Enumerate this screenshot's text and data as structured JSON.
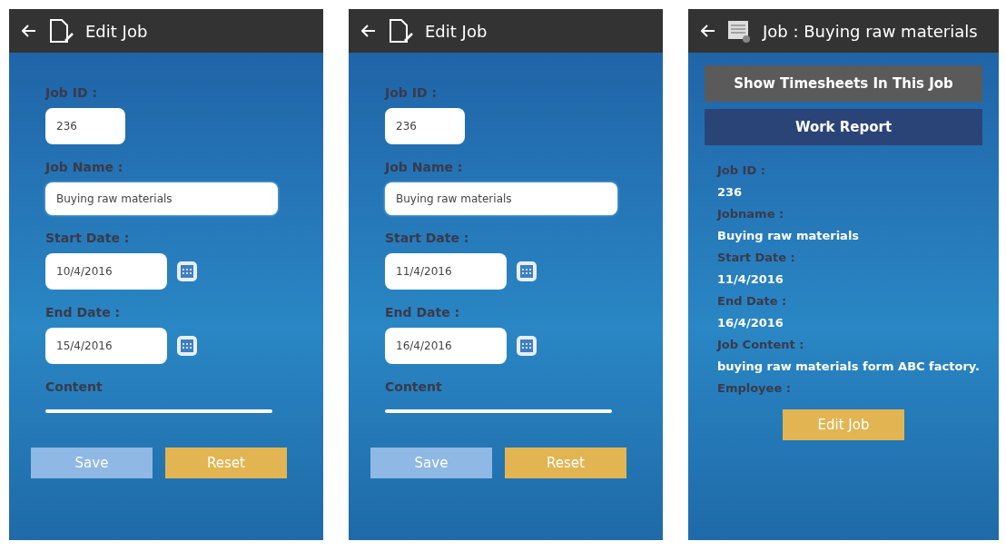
{
  "screens": [
    {
      "kind": "form",
      "title": "Edit Job",
      "fields": [
        {
          "label": "Job ID :",
          "value": "236",
          "kind": "short"
        },
        {
          "label": "Job Name :",
          "value": "Buying raw materials",
          "kind": "wide"
        },
        {
          "label": "Start Date :",
          "value": "10/4/2016",
          "kind": "date"
        },
        {
          "label": "End Date :",
          "value": "15/4/2016",
          "kind": "date"
        },
        {
          "label": "Content",
          "kind": "area"
        }
      ],
      "buttons": [
        {
          "label": "Save",
          "kind": "save"
        },
        {
          "label": "Reset",
          "kind": "reset"
        }
      ]
    },
    {
      "kind": "form",
      "title": "Edit Job",
      "fields": [
        {
          "label": "Job ID :",
          "value": "236",
          "kind": "short"
        },
        {
          "label": "Job Name :",
          "value": "Buying raw materials",
          "kind": "wide"
        },
        {
          "label": "Start Date :",
          "value": "11/4/2016",
          "kind": "date"
        },
        {
          "label": "End Date :",
          "value": "16/4/2016",
          "kind": "date"
        },
        {
          "label": "Content",
          "kind": "area"
        }
      ],
      "buttons": [
        {
          "label": "Save",
          "kind": "save"
        },
        {
          "label": "Reset",
          "kind": "reset"
        }
      ]
    },
    {
      "kind": "details",
      "title": "Job : Buying raw materials",
      "actions": [
        {
          "label": "Show Timesheets In This Job",
          "kind": "grey"
        },
        {
          "label": "Work Report",
          "kind": "navy"
        }
      ],
      "details": [
        {
          "label": "Job ID :",
          "value": "236"
        },
        {
          "label": "Jobname :",
          "value": "Buying raw materials"
        },
        {
          "label": "Start Date :",
          "value": "11/4/2016"
        },
        {
          "label": "End Date :",
          "value": "16/4/2016"
        },
        {
          "label": "Job Content :",
          "value": "buying raw materials form ABC factory."
        },
        {
          "label": "Employee :"
        }
      ],
      "buttons": [
        {
          "label": "Edit Job",
          "kind": "reset"
        }
      ]
    }
  ]
}
